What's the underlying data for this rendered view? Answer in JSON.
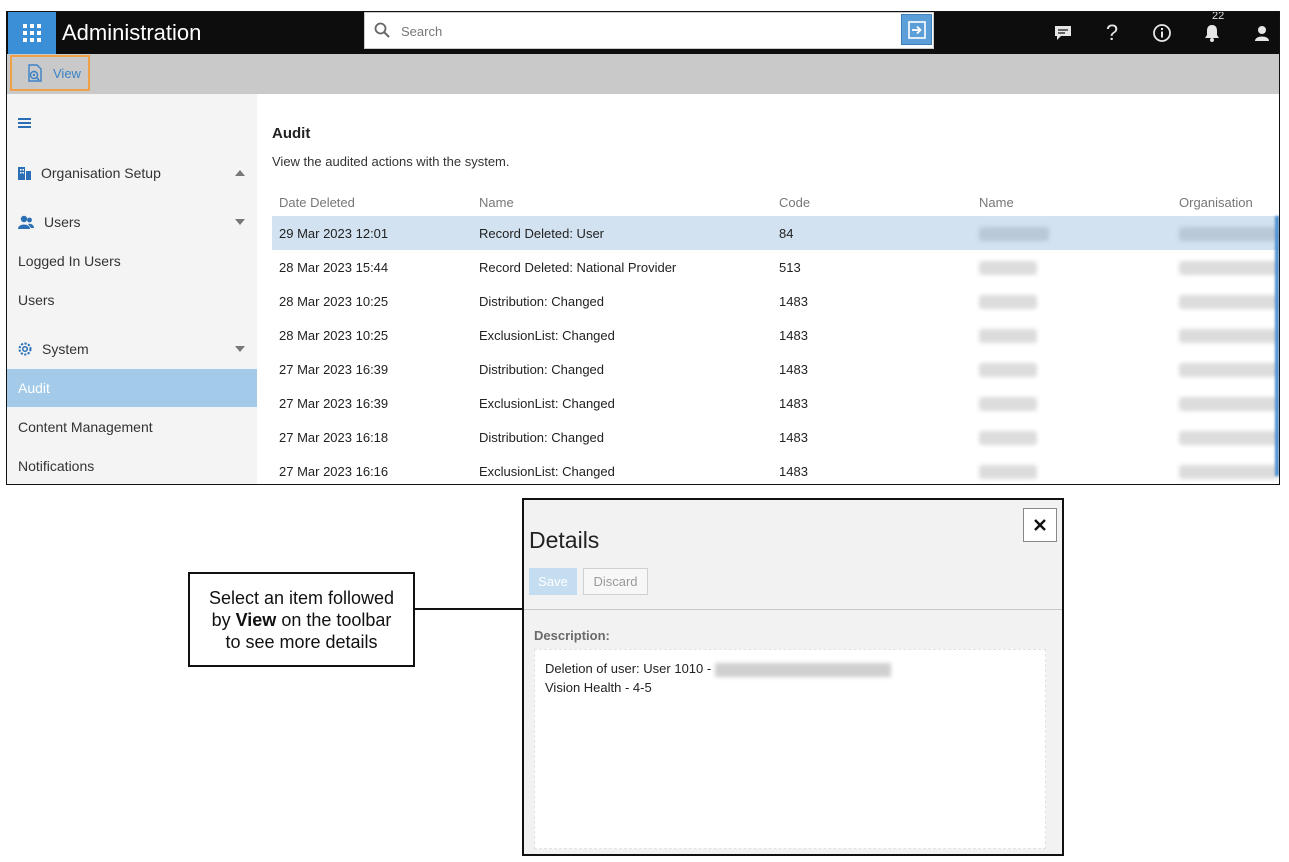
{
  "header": {
    "app_title": "Administration",
    "search_placeholder": "Search",
    "notification_count": "22"
  },
  "toolbar": {
    "view_label": "View"
  },
  "sidebar": {
    "sections": [
      {
        "label": "Organisation Setup",
        "icon": "building-icon",
        "expanded": false
      },
      {
        "label": "Users",
        "icon": "users-icon",
        "expanded": true
      },
      {
        "label": "Logged In Users"
      },
      {
        "label": "Users"
      },
      {
        "label": "System",
        "icon": "gear-icon",
        "expanded": true
      },
      {
        "label": "Audit",
        "active": true
      },
      {
        "label": "Content Management"
      },
      {
        "label": "Notifications"
      }
    ]
  },
  "main": {
    "title": "Audit",
    "subtitle": "View the audited actions with the system.",
    "columns": [
      "Date Deleted",
      "Name",
      "Code",
      "Name",
      "Organisation"
    ],
    "rows": [
      {
        "date": "29 Mar 2023 12:01",
        "name": "Record Deleted: User",
        "code": "84",
        "selected": true
      },
      {
        "date": "28 Mar 2023 15:44",
        "name": "Record Deleted: National Provider",
        "code": "513"
      },
      {
        "date": "28 Mar 2023 10:25",
        "name": "Distribution: Changed",
        "code": "1483"
      },
      {
        "date": "28 Mar 2023 10:25",
        "name": "ExclusionList: Changed",
        "code": "1483"
      },
      {
        "date": "27 Mar 2023 16:39",
        "name": "Distribution: Changed",
        "code": "1483"
      },
      {
        "date": "27 Mar 2023 16:39",
        "name": "ExclusionList: Changed",
        "code": "1483"
      },
      {
        "date": "27 Mar 2023 16:18",
        "name": "Distribution: Changed",
        "code": "1483"
      },
      {
        "date": "27 Mar 2023 16:16",
        "name": "ExclusionList: Changed",
        "code": "1483"
      }
    ]
  },
  "callout": {
    "line1": "Select an item followed",
    "line2_prefix": "by ",
    "line2_bold": "View",
    "line2_suffix": " on the toolbar",
    "line3": "to see more details"
  },
  "dialog": {
    "title": "Details",
    "save_label": "Save",
    "discard_label": "Discard",
    "description_label": "Description:",
    "description_line1": "Deletion of user: User 1010 -",
    "description_line2": "Vision Health - 4-5"
  },
  "colors": {
    "accent": "#3a8fd6",
    "selected_row": "#d2e2f0",
    "active_nav": "#a3cbe9",
    "highlight_border": "#f0a049"
  }
}
